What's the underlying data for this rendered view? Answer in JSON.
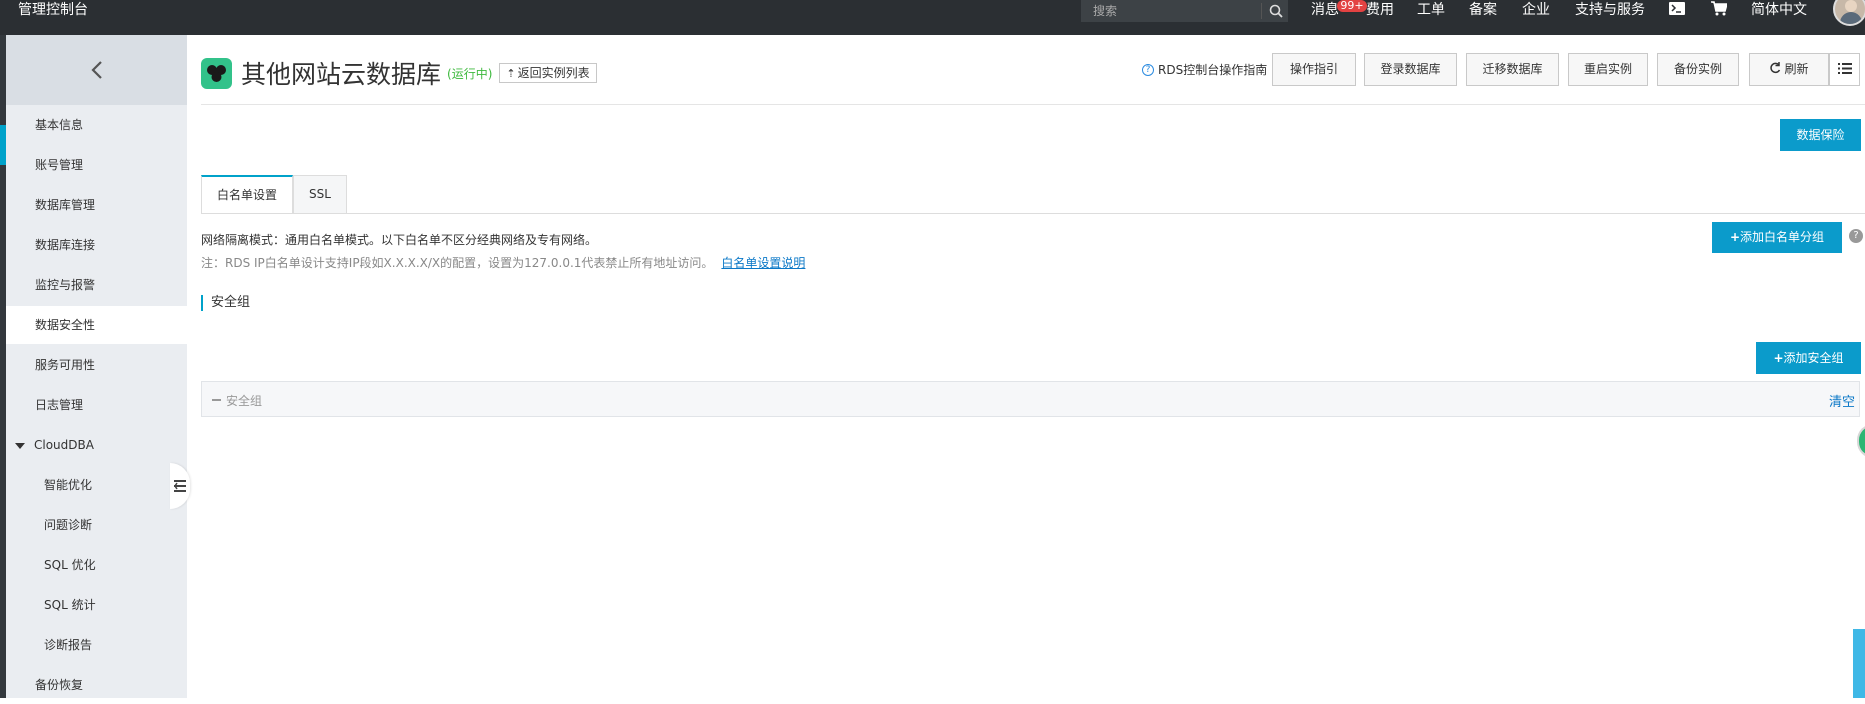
{
  "topbar": {
    "brand": "管理控制台",
    "search_placeholder": "搜索",
    "nav": [
      "消息",
      "费用",
      "工单",
      "备案",
      "企业",
      "支持与服务",
      "简体中文"
    ],
    "badge": "99+"
  },
  "sidebar": {
    "items": [
      {
        "label": "基本信息"
      },
      {
        "label": "账号管理"
      },
      {
        "label": "数据库管理"
      },
      {
        "label": "数据库连接"
      },
      {
        "label": "监控与报警"
      },
      {
        "label": "数据安全性"
      },
      {
        "label": "服务可用性"
      },
      {
        "label": "日志管理"
      },
      {
        "label": "CloudDBA"
      },
      {
        "label": "智能优化"
      },
      {
        "label": "问题诊断"
      },
      {
        "label": "SQL 优化"
      },
      {
        "label": "SQL 统计"
      },
      {
        "label": "诊断报告"
      },
      {
        "label": "备份恢复"
      }
    ],
    "active_index": 5
  },
  "header": {
    "title": "其他网站云数据库",
    "status": "(运行中)",
    "back_label": "返回实例列表",
    "help_link": "RDS控制台操作指南",
    "toolbar": [
      "操作指引",
      "登录数据库",
      "迁移数据库",
      "重启实例",
      "备份实例",
      "刷新"
    ]
  },
  "main": {
    "data_protect": "数据保险",
    "tabs": [
      "白名单设置",
      "SSL"
    ],
    "info_line1": "网络隔离模式：通用白名单模式。以下白名单不区分经典网络及专有网络。",
    "info_line2": "注：RDS IP白名单设计支持IP段如X.X.X.X/X的配置，设置为127.0.0.1代表禁止所有地址访问。",
    "info_link": "白名单设置说明",
    "add_whitelist": "添加白名单分组",
    "help_mark": "?",
    "section_title": "安全组",
    "add_sg": "添加安全组",
    "sg_panel_label": "安全组",
    "clear": "清空"
  },
  "colors": {
    "accent": "#0b9bcb",
    "topbar": "#2b2f33",
    "sidebar": "#eaedf1",
    "status_green": "#3db93d",
    "logo": "#32c28a"
  }
}
